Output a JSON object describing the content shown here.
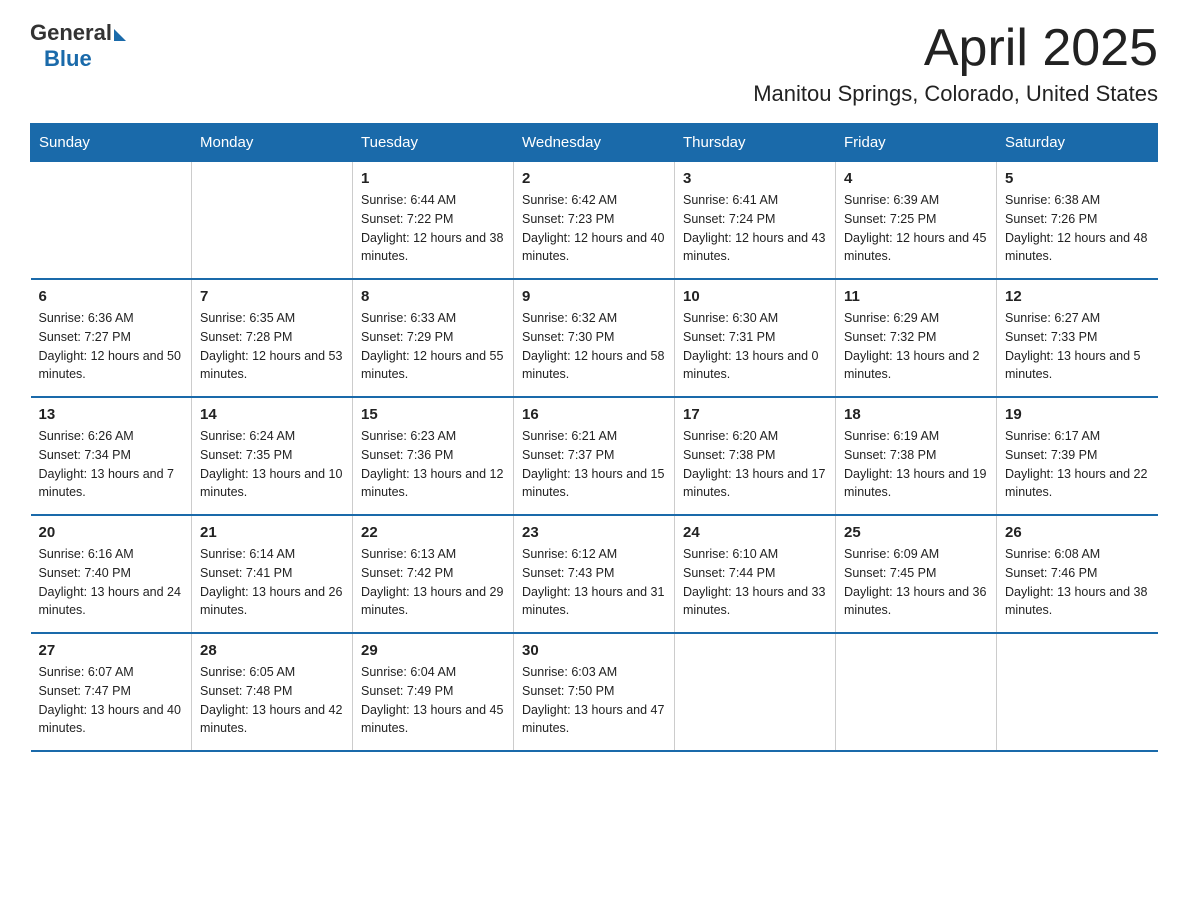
{
  "logo": {
    "general": "General",
    "blue": "Blue"
  },
  "title": "April 2025",
  "location": "Manitou Springs, Colorado, United States",
  "days_of_week": [
    "Sunday",
    "Monday",
    "Tuesday",
    "Wednesday",
    "Thursday",
    "Friday",
    "Saturday"
  ],
  "weeks": [
    [
      {
        "day": "",
        "sunrise": "",
        "sunset": "",
        "daylight": ""
      },
      {
        "day": "",
        "sunrise": "",
        "sunset": "",
        "daylight": ""
      },
      {
        "day": "1",
        "sunrise": "Sunrise: 6:44 AM",
        "sunset": "Sunset: 7:22 PM",
        "daylight": "Daylight: 12 hours and 38 minutes."
      },
      {
        "day": "2",
        "sunrise": "Sunrise: 6:42 AM",
        "sunset": "Sunset: 7:23 PM",
        "daylight": "Daylight: 12 hours and 40 minutes."
      },
      {
        "day": "3",
        "sunrise": "Sunrise: 6:41 AM",
        "sunset": "Sunset: 7:24 PM",
        "daylight": "Daylight: 12 hours and 43 minutes."
      },
      {
        "day": "4",
        "sunrise": "Sunrise: 6:39 AM",
        "sunset": "Sunset: 7:25 PM",
        "daylight": "Daylight: 12 hours and 45 minutes."
      },
      {
        "day": "5",
        "sunrise": "Sunrise: 6:38 AM",
        "sunset": "Sunset: 7:26 PM",
        "daylight": "Daylight: 12 hours and 48 minutes."
      }
    ],
    [
      {
        "day": "6",
        "sunrise": "Sunrise: 6:36 AM",
        "sunset": "Sunset: 7:27 PM",
        "daylight": "Daylight: 12 hours and 50 minutes."
      },
      {
        "day": "7",
        "sunrise": "Sunrise: 6:35 AM",
        "sunset": "Sunset: 7:28 PM",
        "daylight": "Daylight: 12 hours and 53 minutes."
      },
      {
        "day": "8",
        "sunrise": "Sunrise: 6:33 AM",
        "sunset": "Sunset: 7:29 PM",
        "daylight": "Daylight: 12 hours and 55 minutes."
      },
      {
        "day": "9",
        "sunrise": "Sunrise: 6:32 AM",
        "sunset": "Sunset: 7:30 PM",
        "daylight": "Daylight: 12 hours and 58 minutes."
      },
      {
        "day": "10",
        "sunrise": "Sunrise: 6:30 AM",
        "sunset": "Sunset: 7:31 PM",
        "daylight": "Daylight: 13 hours and 0 minutes."
      },
      {
        "day": "11",
        "sunrise": "Sunrise: 6:29 AM",
        "sunset": "Sunset: 7:32 PM",
        "daylight": "Daylight: 13 hours and 2 minutes."
      },
      {
        "day": "12",
        "sunrise": "Sunrise: 6:27 AM",
        "sunset": "Sunset: 7:33 PM",
        "daylight": "Daylight: 13 hours and 5 minutes."
      }
    ],
    [
      {
        "day": "13",
        "sunrise": "Sunrise: 6:26 AM",
        "sunset": "Sunset: 7:34 PM",
        "daylight": "Daylight: 13 hours and 7 minutes."
      },
      {
        "day": "14",
        "sunrise": "Sunrise: 6:24 AM",
        "sunset": "Sunset: 7:35 PM",
        "daylight": "Daylight: 13 hours and 10 minutes."
      },
      {
        "day": "15",
        "sunrise": "Sunrise: 6:23 AM",
        "sunset": "Sunset: 7:36 PM",
        "daylight": "Daylight: 13 hours and 12 minutes."
      },
      {
        "day": "16",
        "sunrise": "Sunrise: 6:21 AM",
        "sunset": "Sunset: 7:37 PM",
        "daylight": "Daylight: 13 hours and 15 minutes."
      },
      {
        "day": "17",
        "sunrise": "Sunrise: 6:20 AM",
        "sunset": "Sunset: 7:38 PM",
        "daylight": "Daylight: 13 hours and 17 minutes."
      },
      {
        "day": "18",
        "sunrise": "Sunrise: 6:19 AM",
        "sunset": "Sunset: 7:38 PM",
        "daylight": "Daylight: 13 hours and 19 minutes."
      },
      {
        "day": "19",
        "sunrise": "Sunrise: 6:17 AM",
        "sunset": "Sunset: 7:39 PM",
        "daylight": "Daylight: 13 hours and 22 minutes."
      }
    ],
    [
      {
        "day": "20",
        "sunrise": "Sunrise: 6:16 AM",
        "sunset": "Sunset: 7:40 PM",
        "daylight": "Daylight: 13 hours and 24 minutes."
      },
      {
        "day": "21",
        "sunrise": "Sunrise: 6:14 AM",
        "sunset": "Sunset: 7:41 PM",
        "daylight": "Daylight: 13 hours and 26 minutes."
      },
      {
        "day": "22",
        "sunrise": "Sunrise: 6:13 AM",
        "sunset": "Sunset: 7:42 PM",
        "daylight": "Daylight: 13 hours and 29 minutes."
      },
      {
        "day": "23",
        "sunrise": "Sunrise: 6:12 AM",
        "sunset": "Sunset: 7:43 PM",
        "daylight": "Daylight: 13 hours and 31 minutes."
      },
      {
        "day": "24",
        "sunrise": "Sunrise: 6:10 AM",
        "sunset": "Sunset: 7:44 PM",
        "daylight": "Daylight: 13 hours and 33 minutes."
      },
      {
        "day": "25",
        "sunrise": "Sunrise: 6:09 AM",
        "sunset": "Sunset: 7:45 PM",
        "daylight": "Daylight: 13 hours and 36 minutes."
      },
      {
        "day": "26",
        "sunrise": "Sunrise: 6:08 AM",
        "sunset": "Sunset: 7:46 PM",
        "daylight": "Daylight: 13 hours and 38 minutes."
      }
    ],
    [
      {
        "day": "27",
        "sunrise": "Sunrise: 6:07 AM",
        "sunset": "Sunset: 7:47 PM",
        "daylight": "Daylight: 13 hours and 40 minutes."
      },
      {
        "day": "28",
        "sunrise": "Sunrise: 6:05 AM",
        "sunset": "Sunset: 7:48 PM",
        "daylight": "Daylight: 13 hours and 42 minutes."
      },
      {
        "day": "29",
        "sunrise": "Sunrise: 6:04 AM",
        "sunset": "Sunset: 7:49 PM",
        "daylight": "Daylight: 13 hours and 45 minutes."
      },
      {
        "day": "30",
        "sunrise": "Sunrise: 6:03 AM",
        "sunset": "Sunset: 7:50 PM",
        "daylight": "Daylight: 13 hours and 47 minutes."
      },
      {
        "day": "",
        "sunrise": "",
        "sunset": "",
        "daylight": ""
      },
      {
        "day": "",
        "sunrise": "",
        "sunset": "",
        "daylight": ""
      },
      {
        "day": "",
        "sunrise": "",
        "sunset": "",
        "daylight": ""
      }
    ]
  ]
}
